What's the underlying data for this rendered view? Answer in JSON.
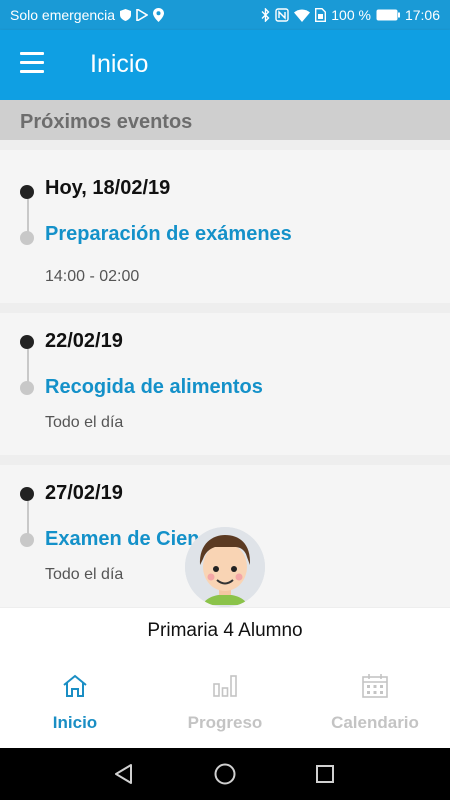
{
  "status_bar": {
    "carrier": "Solo emergencia",
    "battery": "100 %",
    "time": "17:06"
  },
  "app_bar": {
    "title": "Inicio"
  },
  "section": {
    "title": "Próximos eventos"
  },
  "events": [
    {
      "date": "Hoy, 18/02/19",
      "title": "Preparación de exámenes",
      "time": "14:00 - 02:00"
    },
    {
      "date": "22/02/19",
      "title": "Recogida de alimentos",
      "time": "Todo el día"
    },
    {
      "date": "27/02/19",
      "title": "Examen de Cien",
      "time": "Todo el día"
    }
  ],
  "profile": {
    "name": "Primaria 4 Alumno"
  },
  "bottom_nav": [
    {
      "label": "Inicio",
      "icon": "home-icon",
      "active": true
    },
    {
      "label": "Progreso",
      "icon": "bar-chart-icon",
      "active": false
    },
    {
      "label": "Calendario",
      "icon": "calendar-icon",
      "active": false
    }
  ],
  "colors": {
    "primary": "#0f9fe3",
    "link": "#1491c9",
    "active_nav": "#1a8ec4",
    "inactive_nav": "#c4c4c4"
  }
}
